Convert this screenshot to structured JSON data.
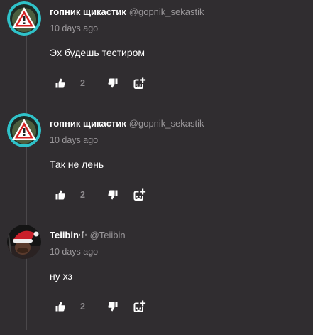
{
  "comments": [
    {
      "username": "гопник щикастик",
      "handle": "@gopnik_sekastik",
      "timestamp": "10 days ago",
      "text": "Эх будешь тестиром",
      "likes": "2",
      "avatar_icon": "warning-triangle-avatar"
    },
    {
      "username": "гопник щикастик",
      "handle": "@gopnik_sekastik",
      "timestamp": "10 days ago",
      "text": "Так не лень",
      "likes": "2",
      "avatar_icon": "warning-triangle-avatar"
    },
    {
      "username": "Teiibin☩",
      "handle": "@Teiibin",
      "timestamp": "10 days ago",
      "text": "ну хз",
      "likes": "2",
      "avatar_icon": "santa-hat-avatar"
    }
  ],
  "colors": {
    "background": "#302d30",
    "muted_text": "#9a979a",
    "accent_teal": "#2fc2c9"
  }
}
